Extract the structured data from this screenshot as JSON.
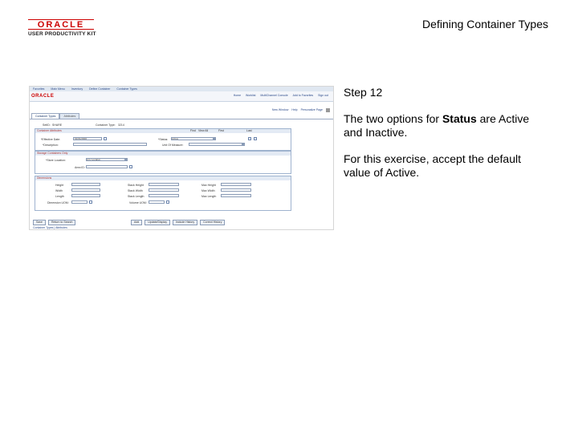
{
  "header": {
    "logo_word": "ORACLE",
    "logo_sub": "USER PRODUCTIVITY KIT",
    "doc_title": "Defining Container Types"
  },
  "step": {
    "title": "Step 12",
    "line1_prefix": "The two options for ",
    "line1_bold": "Status",
    "line1_suffix": " are Active and Inactive.",
    "line2": "For this exercise, accept the default value of Active."
  },
  "screenshot": {
    "topbar_items": [
      "Favorites",
      "Main Menu",
      "Inventory",
      "Define Container",
      "Container Types"
    ],
    "brand": "ORACLE",
    "nav_links": [
      "Home",
      "Worklist",
      "MultiChannel Console",
      "Add to Favorites",
      "Sign out"
    ],
    "page_nav": [
      "New Window",
      "Help",
      "Personalize Page"
    ],
    "tabs": [
      "Container Types",
      "Attributes"
    ],
    "setid_label": "SetID:",
    "setid_value": "SHARE",
    "container_type_label": "Container Type:",
    "container_type_value": "3214",
    "section1_title": "Container Attributes",
    "find_links": [
      "Find",
      "View All",
      "First",
      "Last"
    ],
    "effective_date_label": "*Effective Date:",
    "effective_date_value": "01/01/2000",
    "status_label": "*Status:",
    "status_value": "Active",
    "description_label": "*Description:",
    "unit_label": "Unit Of Measure:",
    "section2_title": "Storage Containers Only",
    "storage_location_label": "*Store Location:",
    "storage_location_value": "Any Location",
    "storage_id_label": "Area ID:",
    "section3_title": "Dimensions",
    "dims_left": [
      "Height",
      "Width",
      "Length"
    ],
    "dims_mid": [
      "Stack Height",
      "Stack Width",
      "Stack Length"
    ],
    "dims_right": [
      "Max Height",
      "Max Width",
      "Max Length"
    ],
    "dim_uom_label": "Dimension UOM:",
    "volume_uom_label": "Volume UOM:",
    "buttons_left": [
      "Save",
      "Return to Search"
    ],
    "buttons_right": [
      "Add",
      "Update/Display",
      "Include History",
      "Correct History"
    ],
    "footer_links": "Container Types | Attributes"
  }
}
